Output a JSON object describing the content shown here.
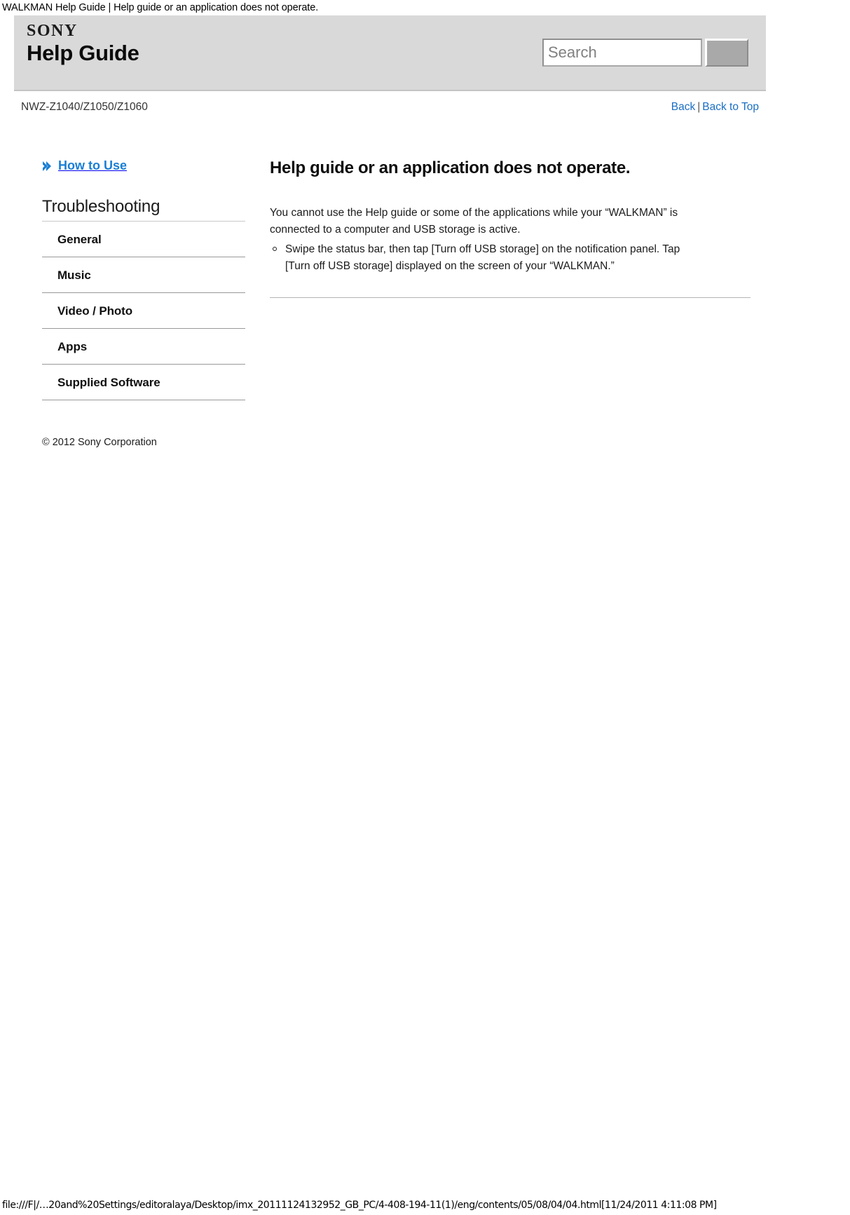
{
  "print_header": {
    "text": "WALKMAN Help Guide | Help guide or an application does not operate."
  },
  "banner": {
    "logo_text": "SONY",
    "title": "Help Guide",
    "search": {
      "placeholder": "Search",
      "value": "",
      "button_label": ""
    }
  },
  "meta": {
    "model": "NWZ-Z1040/Z1050/Z1060",
    "nav": {
      "back": "Back",
      "separator": "|",
      "back_to_top": "Back to Top"
    }
  },
  "sidebar": {
    "how_to_use": "How to Use",
    "section_title": "Troubleshooting",
    "items": [
      {
        "label": "General"
      },
      {
        "label": "Music"
      },
      {
        "label": "Video / Photo"
      },
      {
        "label": "Apps"
      },
      {
        "label": "Supplied Software"
      }
    ],
    "copyright": "© 2012 Sony Corporation"
  },
  "article": {
    "title": "Help guide or an application does not operate.",
    "paragraph": "You cannot use the Help guide or some of the applications while your “WALKMAN” is connected to a computer and USB storage is active.",
    "bullets": [
      "Swipe the status bar, then tap [Turn off USB storage] on the notification panel. Tap [Turn off USB storage] displayed on the screen of your “WALKMAN.”"
    ]
  },
  "footer": {
    "url": "file:///F|/…20and%20Settings/editoralaya/Desktop/imx_20111124132952_GB_PC/4-408-194-11(1)/eng/contents/05/08/04/04.html[11/24/2011 4:11:08 PM]"
  },
  "colors": {
    "banner_background": "#d9d9d9",
    "link_blue": "#1a6fc4",
    "howto_blue": "#1a7fd4",
    "rule_gray": "#999999"
  }
}
